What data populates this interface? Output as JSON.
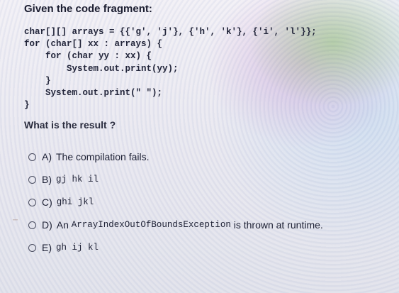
{
  "title": "Given the code fragment:",
  "code_lines": [
    "char[][] arrays = {{'g', 'j'}, {'h', 'k'}, {'i', 'l'}};",
    "for (char[] xx : arrays) {",
    "    for (char yy : xx) {",
    "        System.out.print(yy);",
    "    }",
    "    System.out.print(\" \");",
    "}"
  ],
  "question": "What is the result ?",
  "options": [
    {
      "key": "A)",
      "text": "The compilation fails.",
      "code": "",
      "suffix": ""
    },
    {
      "key": "B)",
      "text": "",
      "code": "gj hk il",
      "suffix": ""
    },
    {
      "key": "C)",
      "text": "",
      "code": "ghi jkl",
      "suffix": ""
    },
    {
      "key": "D)",
      "text": "An ",
      "code": "ArrayIndexOutOfBoundsException",
      "suffix": " is thrown at runtime."
    },
    {
      "key": "E)",
      "text": "",
      "code": "gh ij kl",
      "suffix": ""
    }
  ]
}
